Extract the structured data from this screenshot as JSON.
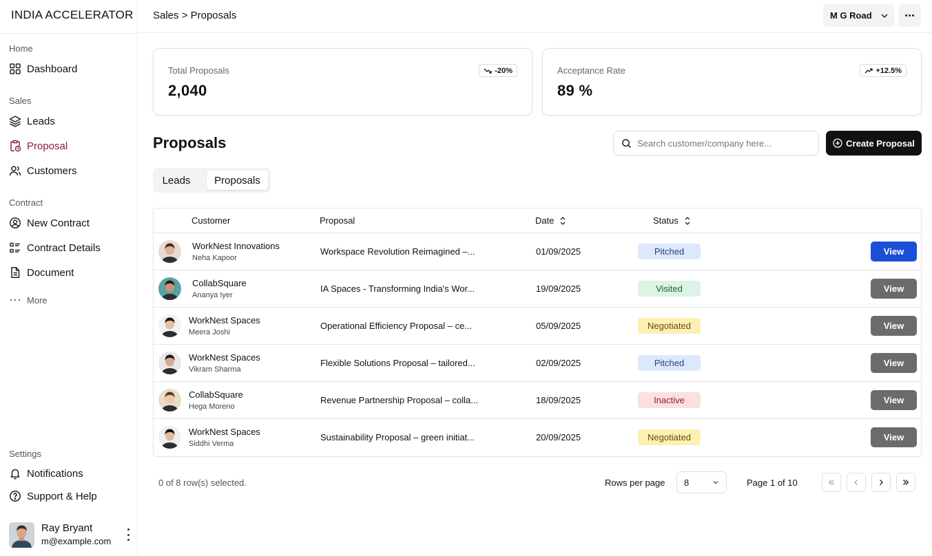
{
  "app": {
    "brand": "INDIA ACCELERATOR"
  },
  "header": {
    "breadcrumb": "Sales > Proposals",
    "branch": "M G Road"
  },
  "sidebar": {
    "sections": {
      "home": "Home",
      "sales": "Sales",
      "contract": "Contract",
      "settings": "Settings"
    },
    "items": {
      "dashboard": "Dashboard",
      "leads": "Leads",
      "proposal": "Proposal",
      "customers": "Customers",
      "new_contract": "New Contract",
      "contract_details": "Contract Details",
      "document": "Document",
      "more": "More",
      "notifications": "Notifications",
      "support": "Support & Help"
    },
    "active_item": "Proposal",
    "user": {
      "name": "Ray Bryant",
      "email": "m@example.com"
    }
  },
  "stats": {
    "total": {
      "label": "Total Proposals",
      "value": "2,040",
      "trend": "-20%",
      "direction": "down"
    },
    "acceptance": {
      "label": "Acceptance Rate",
      "value": "89 %",
      "trend": "+12.5%",
      "direction": "up"
    }
  },
  "main": {
    "title": "Proposals",
    "search_placeholder": "Search customer/company here...",
    "create_label": "Create Proposal",
    "tabs": [
      {
        "label": "Leads",
        "active": false
      },
      {
        "label": "Proposals",
        "active": true
      }
    ]
  },
  "table": {
    "columns": {
      "customer": "Customer",
      "proposal": "Proposal",
      "date": "Date",
      "status": "Status"
    },
    "view_label": "View",
    "rows": [
      {
        "company": "WorkNest Innovations",
        "person": "Neha Kapoor",
        "proposal": "Workspace Revolution Reimagined –...",
        "date": "01/09/2025",
        "status": "Pitched",
        "primary": true
      },
      {
        "company": "CollabSquare",
        "person": "Ananya Iyer",
        "proposal": "IA Spaces - Transforming India's Wor...",
        "date": "19/09/2025",
        "status": "Visited",
        "primary": false
      },
      {
        "company": "WorkNest Spaces",
        "person": "Meera Joshi",
        "proposal": "Operational Efficiency Proposal – ce...",
        "date": "05/09/2025",
        "status": "Negotiated",
        "primary": false
      },
      {
        "company": "WorkNest Spaces",
        "person": "Vikram Sharma",
        "proposal": "Flexible Solutions Proposal – tailored...",
        "date": "02/09/2025",
        "status": "Pitched",
        "primary": false
      },
      {
        "company": "CollabSquare",
        "person": "Hega Moreno",
        "proposal": "Revenue Partnership Proposal – colla...",
        "date": "18/09/2025",
        "status": "Inactive",
        "primary": false
      },
      {
        "company": "WorkNest Spaces",
        "person": "Siddhi Verma",
        "proposal": "Sustainability Proposal – green initiat...",
        "date": "20/09/2025",
        "status": "Negotiated",
        "primary": false
      }
    ]
  },
  "status_colors": {
    "Pitched": {
      "bg": "#dde9fb",
      "fg": "#1f3f8a"
    },
    "Visited": {
      "bg": "#dcf3e6",
      "fg": "#17643c"
    },
    "Negotiated": {
      "bg": "#fcf0b3",
      "fg": "#6b4a00"
    },
    "Inactive": {
      "bg": "#fbe0e0",
      "fg": "#9b1c1c"
    }
  },
  "colors": {
    "primary_view": "#1d4ed8",
    "secondary_view": "#6b6b6b",
    "active_nav": "#8a1c3c"
  },
  "footer": {
    "selection": "0 of 8 row(s) selected.",
    "rows_per_page_label": "Rows per page",
    "rows_per_page": "8",
    "page_label": "Page 1 of 10"
  }
}
